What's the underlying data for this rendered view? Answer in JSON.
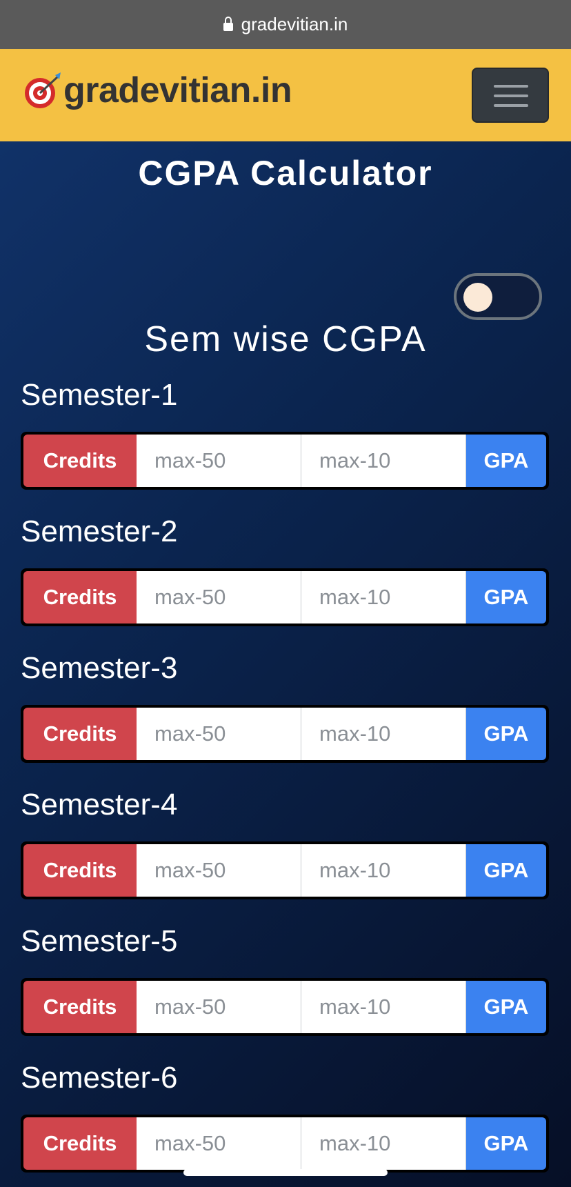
{
  "browser": {
    "url": "gradevitian.in"
  },
  "navbar": {
    "brand": "gradevitian.in"
  },
  "page": {
    "title": "CGPA Calculator",
    "subtitle": "Sem wise CGPA",
    "toggle_on": false
  },
  "semesters": [
    {
      "label": "Semester-1",
      "credits_label": "Credits",
      "credits_placeholder": "max-50",
      "gpa_placeholder": "max-10",
      "gpa_label": "GPA"
    },
    {
      "label": "Semester-2",
      "credits_label": "Credits",
      "credits_placeholder": "max-50",
      "gpa_placeholder": "max-10",
      "gpa_label": "GPA"
    },
    {
      "label": "Semester-3",
      "credits_label": "Credits",
      "credits_placeholder": "max-50",
      "gpa_placeholder": "max-10",
      "gpa_label": "GPA"
    },
    {
      "label": "Semester-4",
      "credits_label": "Credits",
      "credits_placeholder": "max-50",
      "gpa_placeholder": "max-10",
      "gpa_label": "GPA"
    },
    {
      "label": "Semester-5",
      "credits_label": "Credits",
      "credits_placeholder": "max-50",
      "gpa_placeholder": "max-10",
      "gpa_label": "GPA"
    },
    {
      "label": "Semester-6",
      "credits_label": "Credits",
      "credits_placeholder": "max-50",
      "gpa_placeholder": "max-10",
      "gpa_label": "GPA"
    }
  ],
  "colors": {
    "navbar": "#f4c143",
    "credits": "#d0454c",
    "gpa": "#3b82f0"
  }
}
